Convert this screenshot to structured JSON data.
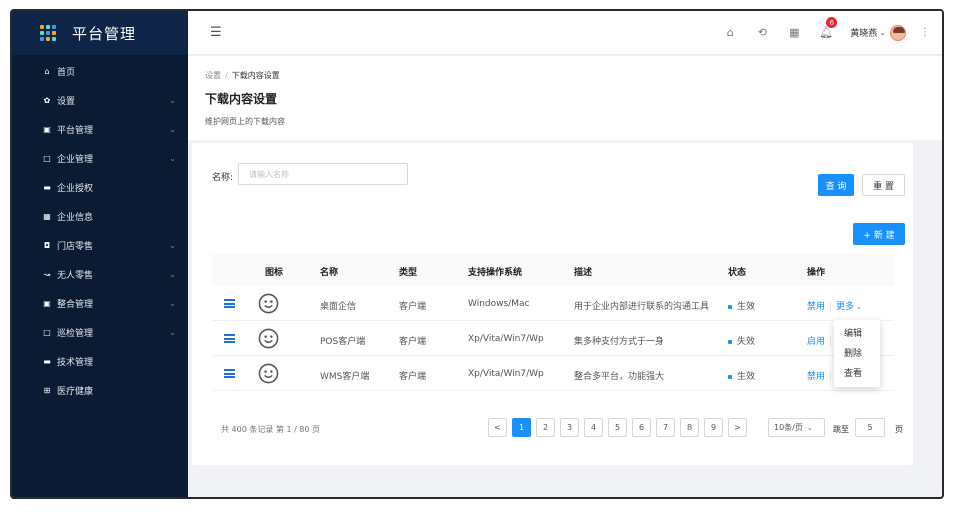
{
  "brand": {
    "title": "平台管理",
    "logo_colors": [
      "#f5a623",
      "#50e3c2",
      "#4a90e2"
    ]
  },
  "sidebar": {
    "items": [
      {
        "icon": "home-icon",
        "glyph": "⌂",
        "label": "首页",
        "has_arrow": false
      },
      {
        "icon": "gear-icon",
        "glyph": "✿",
        "label": "设置",
        "has_arrow": true
      },
      {
        "icon": "monitor-icon",
        "glyph": "▣",
        "label": "平台管理",
        "has_arrow": true
      },
      {
        "icon": "square-icon",
        "glyph": "□",
        "label": "企业管理",
        "has_arrow": true
      },
      {
        "icon": "screen-icon",
        "glyph": "▬",
        "label": "企业授权",
        "has_arrow": false
      },
      {
        "icon": "grid-icon",
        "glyph": "▦",
        "label": "企业信息",
        "has_arrow": false
      },
      {
        "icon": "bag-icon",
        "glyph": "◘",
        "label": "门店零售",
        "has_arrow": true
      },
      {
        "icon": "trend-icon",
        "glyph": "↝",
        "label": "无人零售",
        "has_arrow": true
      },
      {
        "icon": "monitor-icon",
        "glyph": "▣",
        "label": "整合管理",
        "has_arrow": true
      },
      {
        "icon": "square-icon",
        "glyph": "□",
        "label": "巡检管理",
        "has_arrow": true
      },
      {
        "icon": "screen-icon",
        "glyph": "▬",
        "label": "技术管理",
        "has_arrow": false
      },
      {
        "icon": "plus-box-icon",
        "glyph": "⊞",
        "label": "医疗健康",
        "has_arrow": false
      }
    ]
  },
  "topbar": {
    "notification_count": "6",
    "user_name": "黄晓燕"
  },
  "page": {
    "breadcrumb": [
      "设置",
      "下载内容设置"
    ],
    "breadcrumb_sep": "/",
    "title": "下载内容设置",
    "description": "维护网页上的下载内容"
  },
  "search": {
    "label": "名称:",
    "placeholder": "请输入名称",
    "query_label": "查 询",
    "reset_label": "重 置",
    "new_label": "+ 新 建"
  },
  "table": {
    "columns": [
      "图标",
      "名称",
      "类型",
      "支持操作系统",
      "描述",
      "状态",
      "操作"
    ],
    "rows": [
      {
        "name": "桌面企信",
        "type": "客户端",
        "os": "Windows/Mac",
        "desc": "用于企业内部进行联系的沟通工具",
        "status": "生效",
        "action": "禁用",
        "more": "更多"
      },
      {
        "name": "POS客户端",
        "type": "客户端",
        "os": "Xp/Vita/Win7/Wp",
        "desc": "集多种支付方式于一身",
        "status": "失效",
        "action": "启用",
        "more": ""
      },
      {
        "name": "WMS客户端",
        "type": "客户端",
        "os": "Xp/Vita/Win7/Wp",
        "desc": "整合多平台，功能强大",
        "status": "生效",
        "action": "禁用",
        "more": ""
      }
    ],
    "dropdown": [
      "编辑",
      "删除",
      "查看"
    ]
  },
  "pagination": {
    "total_text": "共 400 条记录 第 1 / 80 页",
    "pages": [
      "1",
      "2",
      "3",
      "4",
      "5",
      "6",
      "7",
      "8",
      "9"
    ],
    "current": "1",
    "prev": "<",
    "next": ">",
    "page_size": "10条/页",
    "jump_label": "跳至",
    "jump_value": "5",
    "jump_suffix": "页"
  },
  "colors": {
    "accent": "#1890ff",
    "sidebar_bg": "#0b1b33",
    "badge": "#f5222d"
  }
}
